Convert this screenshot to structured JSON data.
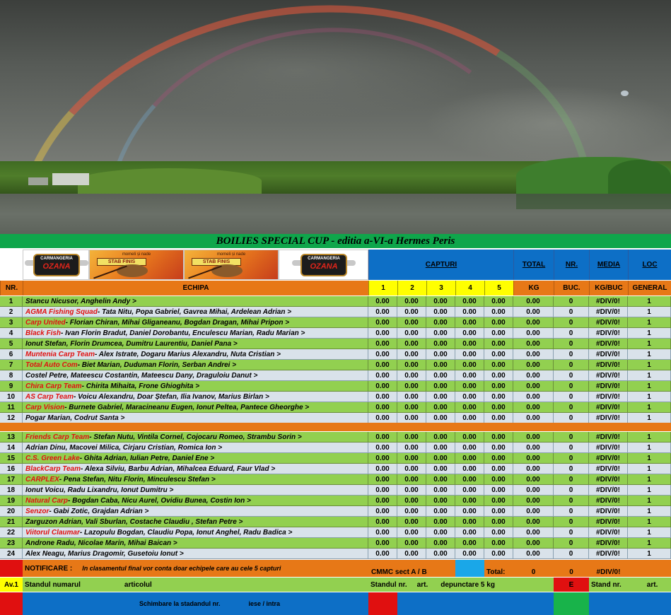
{
  "title": "BOILIES SPECIAL CUP - editia a-VI-a Hermes Peris",
  "logos": {
    "carmangeria_top": "CARMANGERIA",
    "carmangeria_name": "OZANA",
    "stab_sub": "momeli și nade",
    "stab_name": "STAB FINIS"
  },
  "headers": {
    "capturi": "CAPTURI",
    "total": "TOTAL",
    "nr_top": "NR.",
    "media": "MEDIA",
    "loc": "LOC",
    "nr": "NR.",
    "echipa": "ECHIPA",
    "c1": "1",
    "c2": "2",
    "c3": "3",
    "c4": "4",
    "c5": "5",
    "kg": "KG",
    "buc": "BUC.",
    "kgbuc": "KG/BUC",
    "general": "GENERAL"
  },
  "rows_a": [
    {
      "nr": "1",
      "team": "",
      "members": "Stancu Nicusor, Anghelin Andy  >",
      "v": [
        "0.00",
        "0.00",
        "0.00",
        "0.00",
        "0.00"
      ],
      "kg": "0.00",
      "buc": "0",
      "media": "#DIV/0!",
      "loc": "1"
    },
    {
      "nr": "2",
      "team": "AGMA Fishing Squad",
      "members": " - Tata Nitu, Popa Gabriel, Gavrea Mihai, Ardelean Adrian   >",
      "v": [
        "0.00",
        "0.00",
        "0.00",
        "0.00",
        "0.00"
      ],
      "kg": "0.00",
      "buc": "0",
      "media": "#DIV/0!",
      "loc": "1"
    },
    {
      "nr": "3",
      "team": "Carp United",
      "members": " - Florian Chiran, Mihai Gliganeanu, Bogdan Dragan, Mihai Pripon  >",
      "v": [
        "0.00",
        "0.00",
        "0.00",
        "0.00",
        "0.00"
      ],
      "kg": "0.00",
      "buc": "0",
      "media": "#DIV/0!",
      "loc": "1"
    },
    {
      "nr": "4",
      "team": "Black Fish",
      "members": " - Ivan Florin Bradut, Daniel Dorobantu, Enculescu Marian, Radu Marian  >",
      "v": [
        "0.00",
        "0.00",
        "0.00",
        "0.00",
        "0.00"
      ],
      "kg": "0.00",
      "buc": "0",
      "media": "#DIV/0!",
      "loc": "1"
    },
    {
      "nr": "5",
      "team": "",
      "members": "Ionut Stefan, Florin Drumcea, Dumitru Laurentiu, Daniel Pana  >",
      "v": [
        "0.00",
        "0.00",
        "0.00",
        "0.00",
        "0.00"
      ],
      "kg": "0.00",
      "buc": "0",
      "media": "#DIV/0!",
      "loc": "1"
    },
    {
      "nr": "6",
      "team": "Muntenia Carp Team",
      "members": " - Alex Istrate, Dogaru Marius Alexandru, Nuta Cristian  >",
      "v": [
        "0.00",
        "0.00",
        "0.00",
        "0.00",
        "0.00"
      ],
      "kg": "0.00",
      "buc": "0",
      "media": "#DIV/0!",
      "loc": "1"
    },
    {
      "nr": "7",
      "team": "Total Auto Com",
      "members": "  -  Biet Marian, Duduman Florin, Serban Andrei   >",
      "v": [
        "0.00",
        "0.00",
        "0.00",
        "0.00",
        "0.00"
      ],
      "kg": "0.00",
      "buc": "0",
      "media": "#DIV/0!",
      "loc": "1"
    },
    {
      "nr": "8",
      "team": "",
      "members": "Costel Petre, Mateescu Costantin, Mateescu Dany, Draguloiu Danut  >",
      "v": [
        "0.00",
        "0.00",
        "0.00",
        "0.00",
        "0.00"
      ],
      "kg": "0.00",
      "buc": "0",
      "media": "#DIV/0!",
      "loc": "1"
    },
    {
      "nr": "9",
      "team": "Chira Carp Team",
      "members": "  -  Chirita Mihaita, Frone Ghioghita  >",
      "v": [
        "0.00",
        "0.00",
        "0.00",
        "0.00",
        "0.00"
      ],
      "kg": "0.00",
      "buc": "0",
      "media": "#DIV/0!",
      "loc": "1"
    },
    {
      "nr": "10",
      "team": "AS Carp Team",
      "members": "  -  Voicu Alexandru, Doar Ștefan, Ilia Ivanov, Marius Birlan  >",
      "v": [
        "0.00",
        "0.00",
        "0.00",
        "0.00",
        "0.00"
      ],
      "kg": "0.00",
      "buc": "0",
      "media": "#DIV/0!",
      "loc": "1"
    },
    {
      "nr": "11",
      "team": "Carp Vision",
      "members": "  -  Burnete Gabriel, Maracineanu Eugen, Ionut Peltea, Pantece Gheorghe  >",
      "v": [
        "0.00",
        "0.00",
        "0.00",
        "0.00",
        "0.00"
      ],
      "kg": "0.00",
      "buc": "0",
      "media": "#DIV/0!",
      "loc": "1"
    },
    {
      "nr": "12",
      "team": "",
      "members": "Pogar Marian, Codrut Santa  >",
      "v": [
        "0.00",
        "0.00",
        "0.00",
        "0.00",
        "0.00"
      ],
      "kg": "0.00",
      "buc": "0",
      "media": "#DIV/0!",
      "loc": "1"
    }
  ],
  "rows_b": [
    {
      "nr": "13",
      "team": "Friends Carp Team",
      "members": "  -  Stefan Nutu, Vintila Cornel, Cojocaru Romeo, Strambu Sorin  >",
      "v": [
        "0.00",
        "0.00",
        "0.00",
        "0.00",
        "0.00"
      ],
      "kg": "0.00",
      "buc": "0",
      "media": "#DIV/0!",
      "loc": "1"
    },
    {
      "nr": "14",
      "team": "",
      "members": "Adrian Dinu, Macovei Milica, Cirjaru Cristian, Romica Ion  >",
      "v": [
        "0.00",
        "0.00",
        "0.00",
        "0.00",
        "0.00"
      ],
      "kg": "0.00",
      "buc": "0",
      "media": "#DIV/0!",
      "loc": "1"
    },
    {
      "nr": "15",
      "team": "C.S. Green Lake",
      "members": "  -  Ghita Adrian, Iulian Petre, Daniel Ene  >",
      "v": [
        "0.00",
        "0.00",
        "0.00",
        "0.00",
        "0.00"
      ],
      "kg": "0.00",
      "buc": "0",
      "media": "#DIV/0!",
      "loc": "1"
    },
    {
      "nr": "16",
      "team": "BlackCarp Team",
      "members": "  -  Alexa Silviu, Barbu Adrian, Mihalcea Eduard, Faur Vlad   >",
      "v": [
        "0.00",
        "0.00",
        "0.00",
        "0.00",
        "0.00"
      ],
      "kg": "0.00",
      "buc": "0",
      "media": "#DIV/0!",
      "loc": "1"
    },
    {
      "nr": "17",
      "team": "CARPLEX",
      "members": "  -  Pena Stefan, Nitu Florin, Minculescu Stefan >",
      "v": [
        "0.00",
        "0.00",
        "0.00",
        "0.00",
        "0.00"
      ],
      "kg": "0.00",
      "buc": "0",
      "media": "#DIV/0!",
      "loc": "1"
    },
    {
      "nr": "18",
      "team": "",
      "members": "Ionut Voicu, Radu Lixandru, Ionut  Dumitru  >",
      "v": [
        "0.00",
        "0.00",
        "0.00",
        "0.00",
        "0.00"
      ],
      "kg": "0.00",
      "buc": "0",
      "media": "#DIV/0!",
      "loc": "1"
    },
    {
      "nr": "19",
      "team": "Natural Carp",
      "members": "  -  Bogdan Caba, Nicu Aurel, Ovidiu Bunea, Costin Ion  >",
      "v": [
        "0.00",
        "0.00",
        "0.00",
        "0.00",
        "0.00"
      ],
      "kg": "0.00",
      "buc": "0",
      "media": "#DIV/0!",
      "loc": "1"
    },
    {
      "nr": "20",
      "team": "Senzor",
      "members": "  -  Gabi Zotic, Grajdan Adrian  >",
      "v": [
        "0.00",
        "0.00",
        "0.00",
        "0.00",
        "0.00"
      ],
      "kg": "0.00",
      "buc": "0",
      "media": "#DIV/0!",
      "loc": "1"
    },
    {
      "nr": "21",
      "team": "",
      "members": "Zarguzon Adrian, Vali Sburlan, Costache Claudiu , Stefan Petre  >",
      "v": [
        "0.00",
        "0.00",
        "0.00",
        "0.00",
        "0.00"
      ],
      "kg": "0.00",
      "buc": "0",
      "media": "#DIV/0!",
      "loc": "1"
    },
    {
      "nr": "22",
      "team": "Viitorul Claumar",
      "members": "  -  Lazopulu Bogdan, Claudiu Popa, Ionut Anghel, Radu Badica  >",
      "v": [
        "0.00",
        "0.00",
        "0.00",
        "0.00",
        "0.00"
      ],
      "kg": "0.00",
      "buc": "0",
      "media": "#DIV/0!",
      "loc": "1"
    },
    {
      "nr": "23",
      "team": "",
      "members": "Androne Radu, Nicolae Marin, Mihai Baican  >",
      "v": [
        "0.00",
        "0.00",
        "0.00",
        "0.00",
        "0.00"
      ],
      "kg": "0.00",
      "buc": "0",
      "media": "#DIV/0!",
      "loc": "1"
    },
    {
      "nr": "24",
      "team": "",
      "members": "Alex Neagu, Marius Dragomir, Gusetoiu Ionut  >",
      "v": [
        "0.00",
        "0.00",
        "0.00",
        "0.00",
        "0.00"
      ],
      "kg": "0.00",
      "buc": "0",
      "media": "#DIV/0!",
      "loc": "1"
    }
  ],
  "footer": {
    "notificare_label": "NOTIFICARE :",
    "notificare_text": "In clasamentul final vor conta doar echipele care au cele 5 capturi",
    "cmmc": "CMMC sect  A / B",
    "total_label": "Total:",
    "total_kg": "0",
    "total_buc": "0",
    "total_media": "#DIV/0!",
    "av": "Av.1",
    "standul_numarul": "Standul numarul",
    "articolul": "articolul",
    "standul_nr": "Standul  nr.",
    "art": "art.",
    "depunctare": "depunctare 5 kg",
    "e_label": "E",
    "stand_nr": "Stand nr.",
    "art2": "art.",
    "schimbare": "Schimbare la stadandul  nr.",
    "iese_intra": "iese / intra"
  },
  "colors": {
    "title_bar": "#0fa64b",
    "header_blue": "#0d6fc6",
    "header_orange": "#e77817",
    "header_yellow": "#ffff00",
    "row_green": "#92d050",
    "row_grey": "#d9e2ea",
    "team_red": "#e01010"
  }
}
